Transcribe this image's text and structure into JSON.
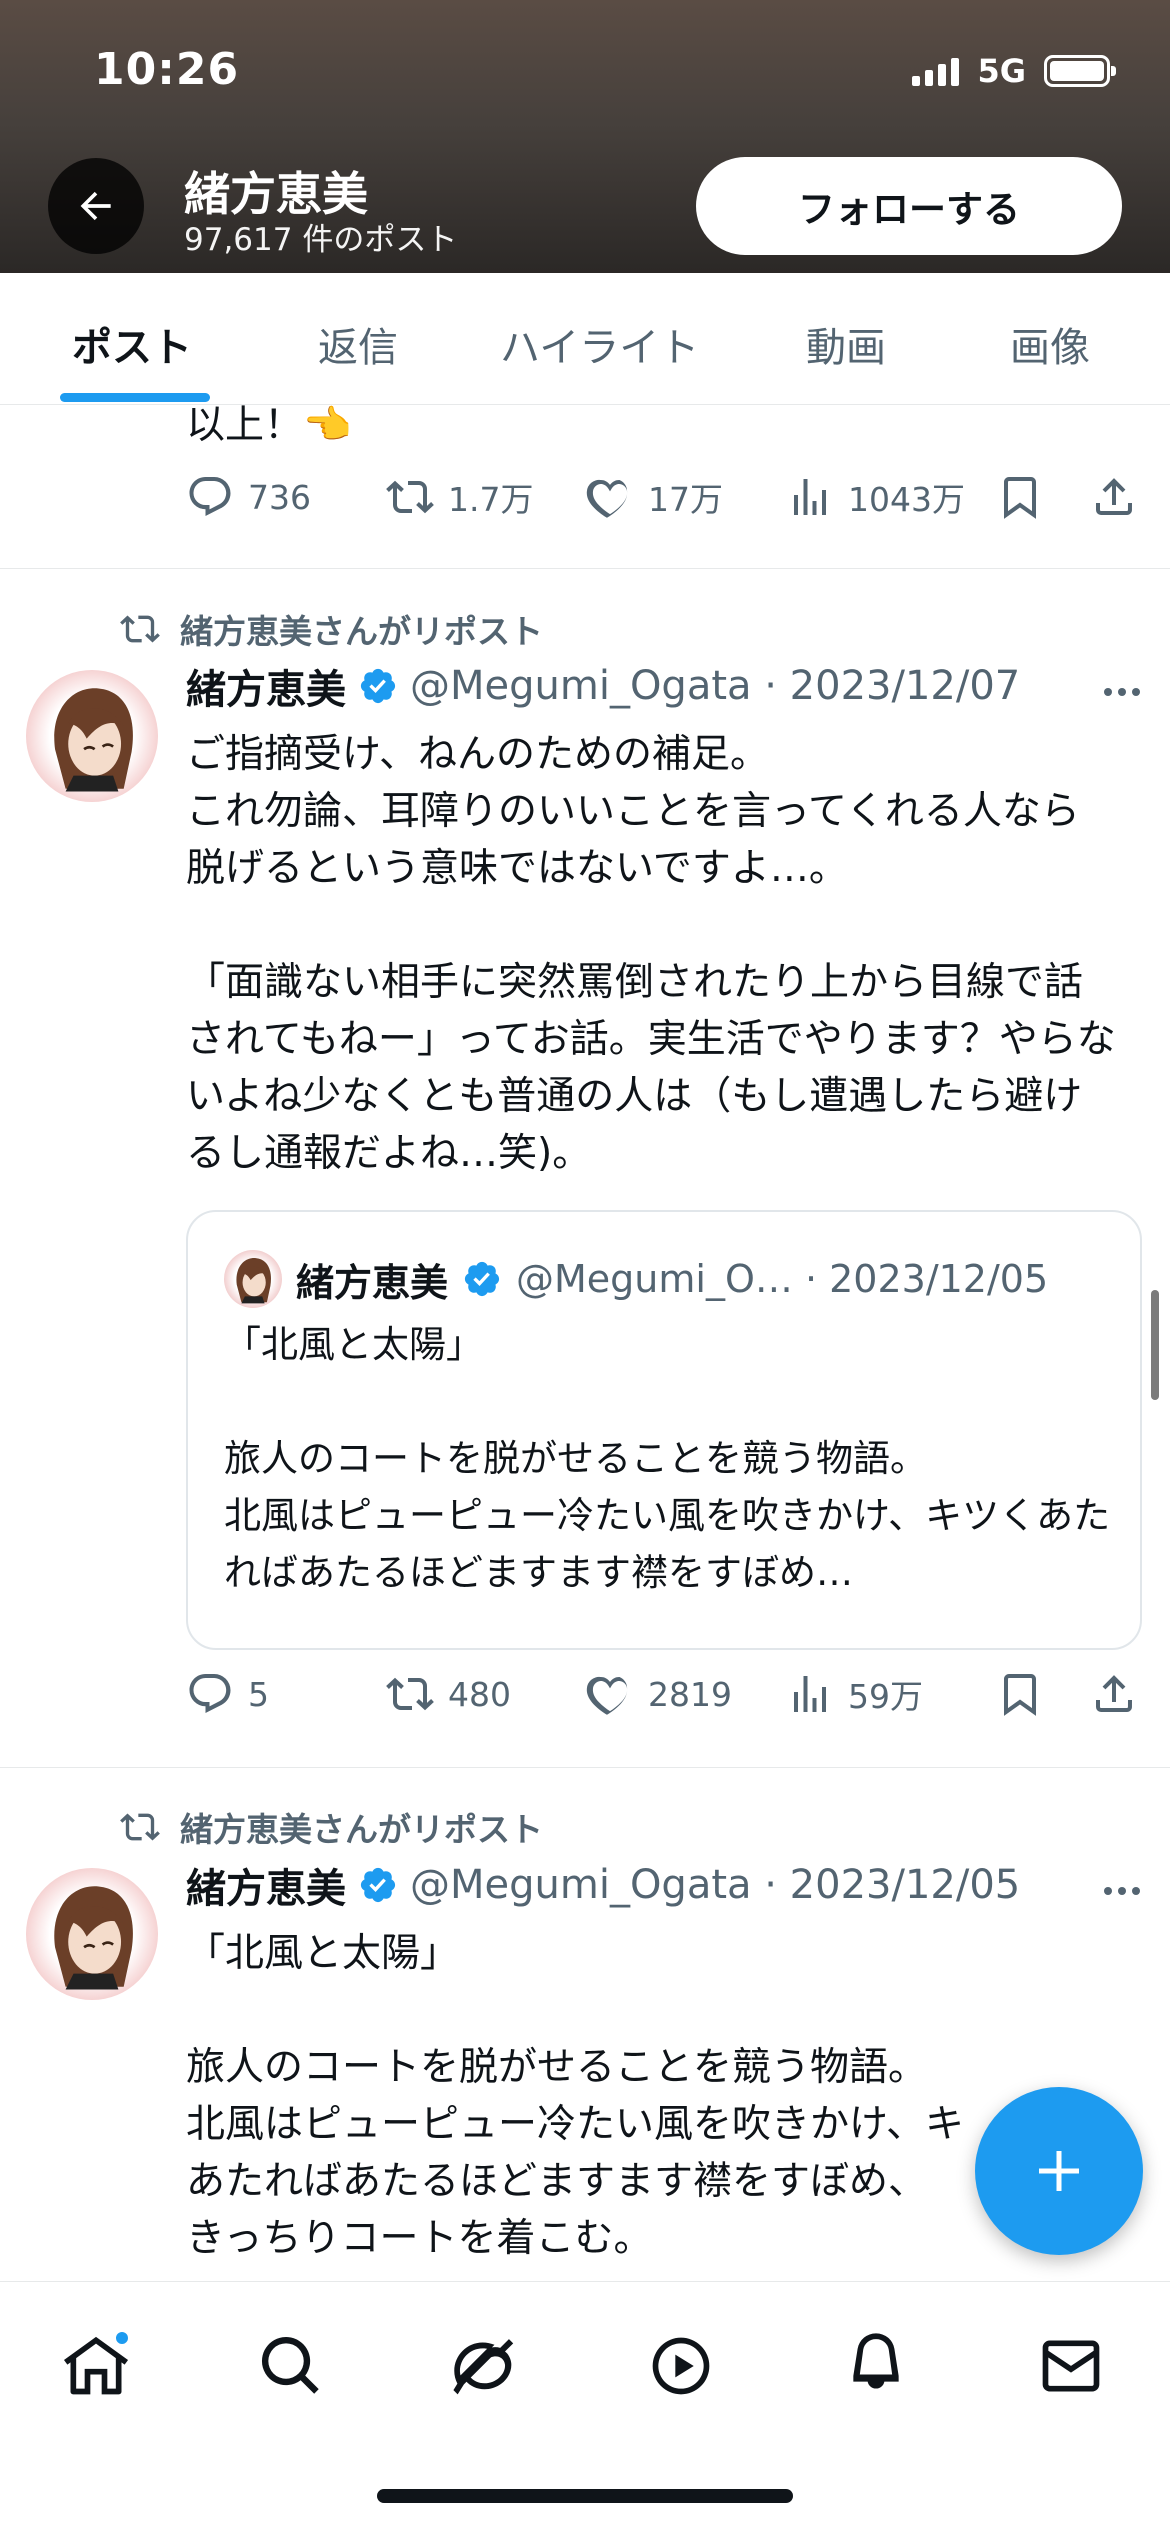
{
  "status_bar": {
    "time": "10:26",
    "network": "5G"
  },
  "header": {
    "name": "緒方恵美",
    "post_count": "97,617 件のポスト",
    "follow_label": "フォローする"
  },
  "tabs": [
    "ポスト",
    "返信",
    "ハイライト",
    "動画",
    "画像"
  ],
  "feed": {
    "partial_post": {
      "text": "以上！👈",
      "actions": {
        "replies": "736",
        "reposts": "1.7万",
        "likes": "17万",
        "views": "1043万"
      }
    },
    "post1": {
      "repost_label": "緒方恵美さんがリポスト",
      "name": "緒方恵美",
      "handle_date": "@Megumi_Ogata · 2023/12/07",
      "text": "ご指摘受け、ねんのための補足。\nこれ勿論、耳障りのいいことを言ってくれる人なら脱げるという意味ではないですよ…。\n\n「面識ない相手に突然罵倒されたり上から目線で話されてもねー」ってお話。実生活でやります？やらないよね少なくとも普通の人は（もし遭遇したら避けるし通報だよね…笑)。",
      "quote": {
        "name": "緒方恵美",
        "handle_date": "@Megumi_O… · 2023/12/05",
        "text": "「北風と太陽」\n\n旅人のコートを脱がせることを競う物語。\n北風はピューピュー冷たい風を吹きかけ、キツくあたればあたるほどますます襟をすぼめ…"
      },
      "actions": {
        "replies": "5",
        "reposts": "480",
        "likes": "2819",
        "views": "59万"
      }
    },
    "post2": {
      "repost_label": "緒方恵美さんがリポスト",
      "name": "緒方恵美",
      "handle_date": "@Megumi_Ogata · 2023/12/05",
      "text": "「北風と太陽」\n\n旅人のコートを脱がせることを競う物語。\n北風はピューピュー冷たい風を吹きかけ、キ\nあたればあたるほどますます襟をすぼめ、\nきっちりコートを着こむ。"
    }
  },
  "colors": {
    "accent": "#1d9bf0",
    "text": "#0f1419",
    "muted": "#536471"
  },
  "bottom_nav": [
    "home-icon",
    "search-icon",
    "grok-icon",
    "video-icon",
    "notifications-icon",
    "messages-icon"
  ]
}
